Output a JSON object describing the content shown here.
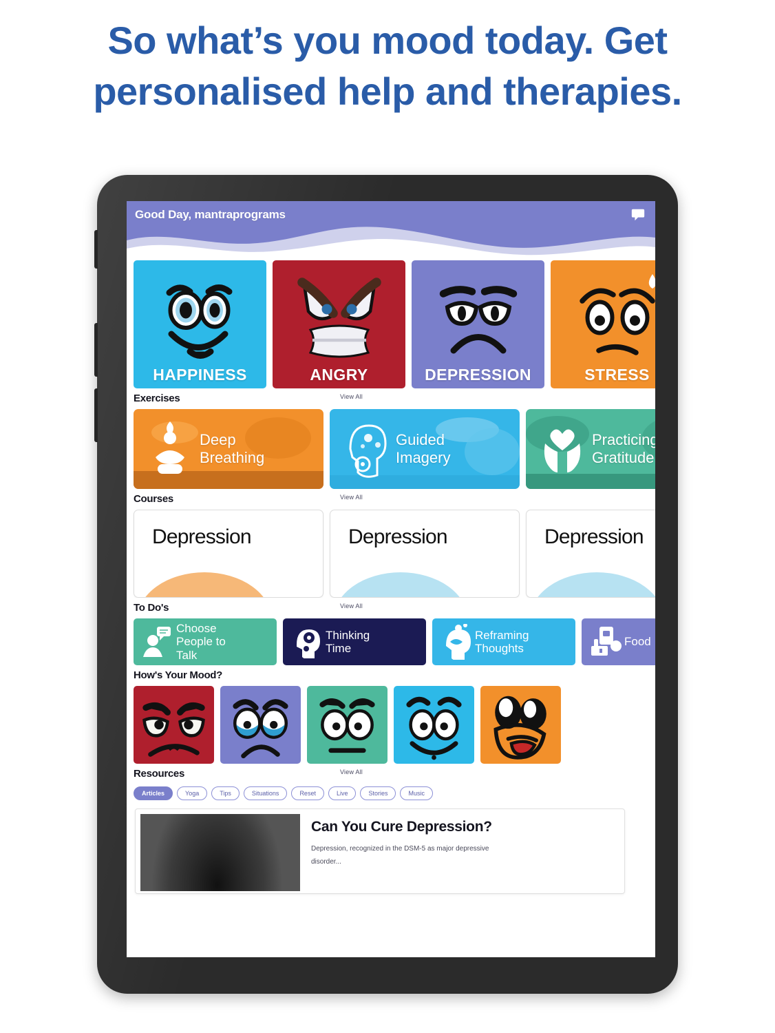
{
  "headline": "So what’s you mood today. Get personalised help and therapies.",
  "colors": {
    "headline": "#2A5CA8",
    "header_purple": "#7A7FCB",
    "cyan": "#2DB9E8",
    "red": "#AF1F2D",
    "orange": "#F2902B",
    "teal": "#4EB99C",
    "navy": "#1B1B54"
  },
  "app": {
    "header": {
      "greeting": "Good Day, mantraprograms",
      "chat_icon": "chat-bubble-icon"
    },
    "view_all_label": "View All",
    "moods": [
      {
        "label": "HAPPINESS",
        "color": "#2DB9E8",
        "face": "happy-face-icon"
      },
      {
        "label": "ANGRY",
        "color": "#AF1F2D",
        "face": "angry-face-icon"
      },
      {
        "label": "DEPRESSION",
        "color": "#7A7FCB",
        "face": "sad-face-icon"
      },
      {
        "label": "STRESS",
        "color": "#F2902B",
        "face": "stressed-face-icon"
      }
    ],
    "sections": {
      "exercises": {
        "title": "Exercises"
      },
      "courses": {
        "title": "Courses"
      },
      "todos": {
        "title": "To Do's"
      },
      "mood_check": {
        "title": "How's Your Mood?"
      },
      "resources": {
        "title": "Resources"
      }
    },
    "exercises": [
      {
        "line1": "Deep",
        "line2": "Breathing",
        "color": "#F2902B",
        "icon": "yoga-meditation-icon"
      },
      {
        "line1": "Guided",
        "line2": "Imagery",
        "color": "#35B6E8",
        "icon": "head-brain-icon"
      },
      {
        "line1": "Practicing",
        "line2": "Gratitude",
        "color": "#4EB99C",
        "icon": "hands-heart-icon"
      }
    ],
    "courses": [
      {
        "title": "Depression",
        "arc_color": "#F6B878"
      },
      {
        "title": "Depression",
        "arc_color": "#B7E2F2"
      },
      {
        "title": "Depression",
        "arc_color": "#B7E2F2"
      }
    ],
    "todos": [
      {
        "line1": "Choose",
        "line2": "People to",
        "line3": "Talk",
        "color": "#4EB99C",
        "icon": "person-speech-icon"
      },
      {
        "line1": "Thinking",
        "line2": "Time",
        "line3": "",
        "color": "#1B1B54",
        "icon": "head-gears-icon"
      },
      {
        "line1": "Reframing",
        "line2": "Thoughts",
        "line3": "",
        "color": "#35B6E8",
        "icon": "head-mind-icon"
      },
      {
        "line1": "Food",
        "line2": "",
        "line3": "",
        "color": "#7A7FCB",
        "icon": "food-basket-icon"
      }
    ],
    "mood_faces": [
      {
        "name": "angry-mood-face",
        "color": "#AF1F2D"
      },
      {
        "name": "sad-mood-face",
        "color": "#7A7FCB"
      },
      {
        "name": "neutral-mood-face",
        "color": "#4EB99C"
      },
      {
        "name": "happy-mood-face",
        "color": "#2DB9E8"
      },
      {
        "name": "very-happy-mood-face",
        "color": "#F2902B"
      }
    ],
    "resource_chips": [
      {
        "label": "Articles",
        "active": true
      },
      {
        "label": "Yoga",
        "active": false
      },
      {
        "label": "Tips",
        "active": false
      },
      {
        "label": "Situations",
        "active": false
      },
      {
        "label": "Reset",
        "active": false
      },
      {
        "label": "Live",
        "active": false
      },
      {
        "label": "Stories",
        "active": false
      },
      {
        "label": "Music",
        "active": false
      }
    ],
    "article": {
      "title": "Can You Cure Depression?",
      "excerpt": "Depression, recognized in the DSM-5 as major depressive disorder..."
    }
  }
}
